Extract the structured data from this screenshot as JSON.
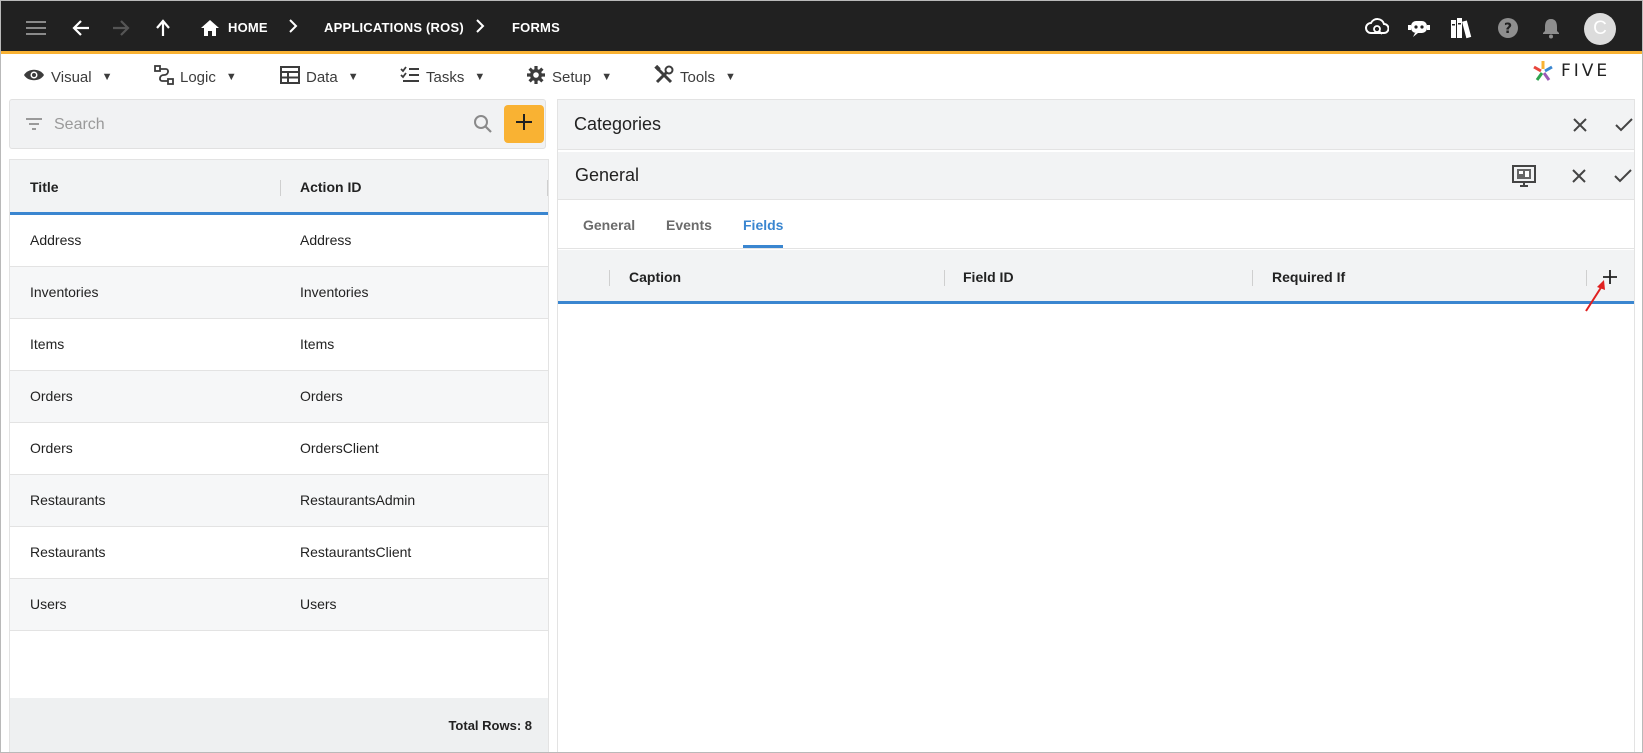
{
  "topbar": {
    "breadcrumbs": [
      "HOME",
      "APPLICATIONS (ROS)",
      "FORMS"
    ],
    "avatar_initial": "C"
  },
  "menu": {
    "items": [
      {
        "label": "Visual",
        "icon": "eye-icon"
      },
      {
        "label": "Logic",
        "icon": "logic-icon"
      },
      {
        "label": "Data",
        "icon": "table-icon"
      },
      {
        "label": "Tasks",
        "icon": "checklist-icon"
      },
      {
        "label": "Setup",
        "icon": "gear-icon"
      },
      {
        "label": "Tools",
        "icon": "tools-icon"
      }
    ],
    "logo_text": "FIVE"
  },
  "search": {
    "placeholder": "Search"
  },
  "list": {
    "columns": [
      "Title",
      "Action ID"
    ],
    "rows": [
      {
        "title": "Address",
        "action_id": "Address"
      },
      {
        "title": "Inventories",
        "action_id": "Inventories"
      },
      {
        "title": "Items",
        "action_id": "Items"
      },
      {
        "title": "Orders",
        "action_id": "Orders"
      },
      {
        "title": "Orders",
        "action_id": "OrdersClient"
      },
      {
        "title": "Restaurants",
        "action_id": "RestaurantsAdmin"
      },
      {
        "title": "Restaurants",
        "action_id": "RestaurantsClient"
      },
      {
        "title": "Users",
        "action_id": "Users"
      }
    ],
    "footer": "Total Rows: 8"
  },
  "detail": {
    "title": "Categories",
    "section_title": "General",
    "tabs": [
      "General",
      "Events",
      "Fields"
    ],
    "active_tab": "Fields",
    "grid_columns": [
      "Caption",
      "Field ID",
      "Required If"
    ]
  },
  "colors": {
    "topbar": "#212121",
    "accent": "#f9b233",
    "active_blue": "#3a86d0",
    "annotation_arrow": "#e02020"
  }
}
